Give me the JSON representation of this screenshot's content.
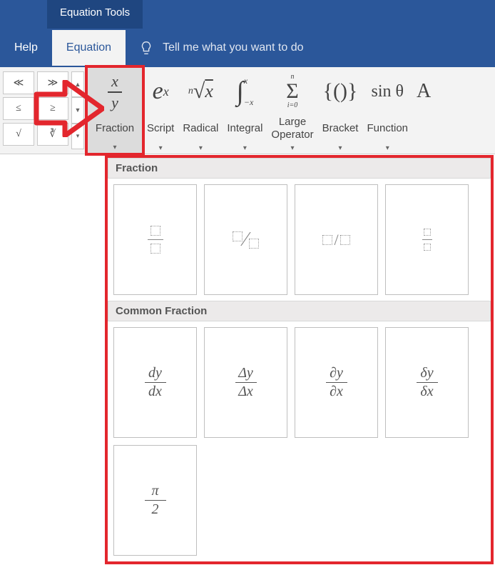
{
  "titlebar": {
    "tools_label": "Equation Tools"
  },
  "tabs": {
    "help": "Help",
    "equation": "Equation",
    "tell_me": "Tell me what you want to do"
  },
  "ribbon": {
    "btns": {
      "ll": "≪",
      "gg": "≫",
      "le_eq": "≤",
      "ge_eq": "≥",
      "sqrt": "√",
      "nroot": "∛"
    },
    "fraction": "Fraction",
    "script": "Script",
    "radical": "Radical",
    "integral": "Integral",
    "large_op": "Large\nOperator",
    "bracket": "Bracket",
    "function": "Function",
    "accent": "A",
    "icons": {
      "fraction": {
        "top": "x",
        "bot": "y"
      },
      "script": "eˣ",
      "radical": "ⁿ√x",
      "integral": "∫",
      "large_op": {
        "top": "n",
        "sigma": "Σ",
        "bot": "i=0"
      },
      "bracket": "{()}",
      "function": "sin θ"
    }
  },
  "gallery": {
    "section1": "Fraction",
    "section2": "Common Fraction",
    "cf": [
      {
        "top": "dy",
        "bot": "dx"
      },
      {
        "top": "Δy",
        "bot": "Δx"
      },
      {
        "top": "∂y",
        "bot": "∂x"
      },
      {
        "top": "δy",
        "bot": "δx"
      },
      {
        "top": "π",
        "bot": "2"
      }
    ]
  }
}
